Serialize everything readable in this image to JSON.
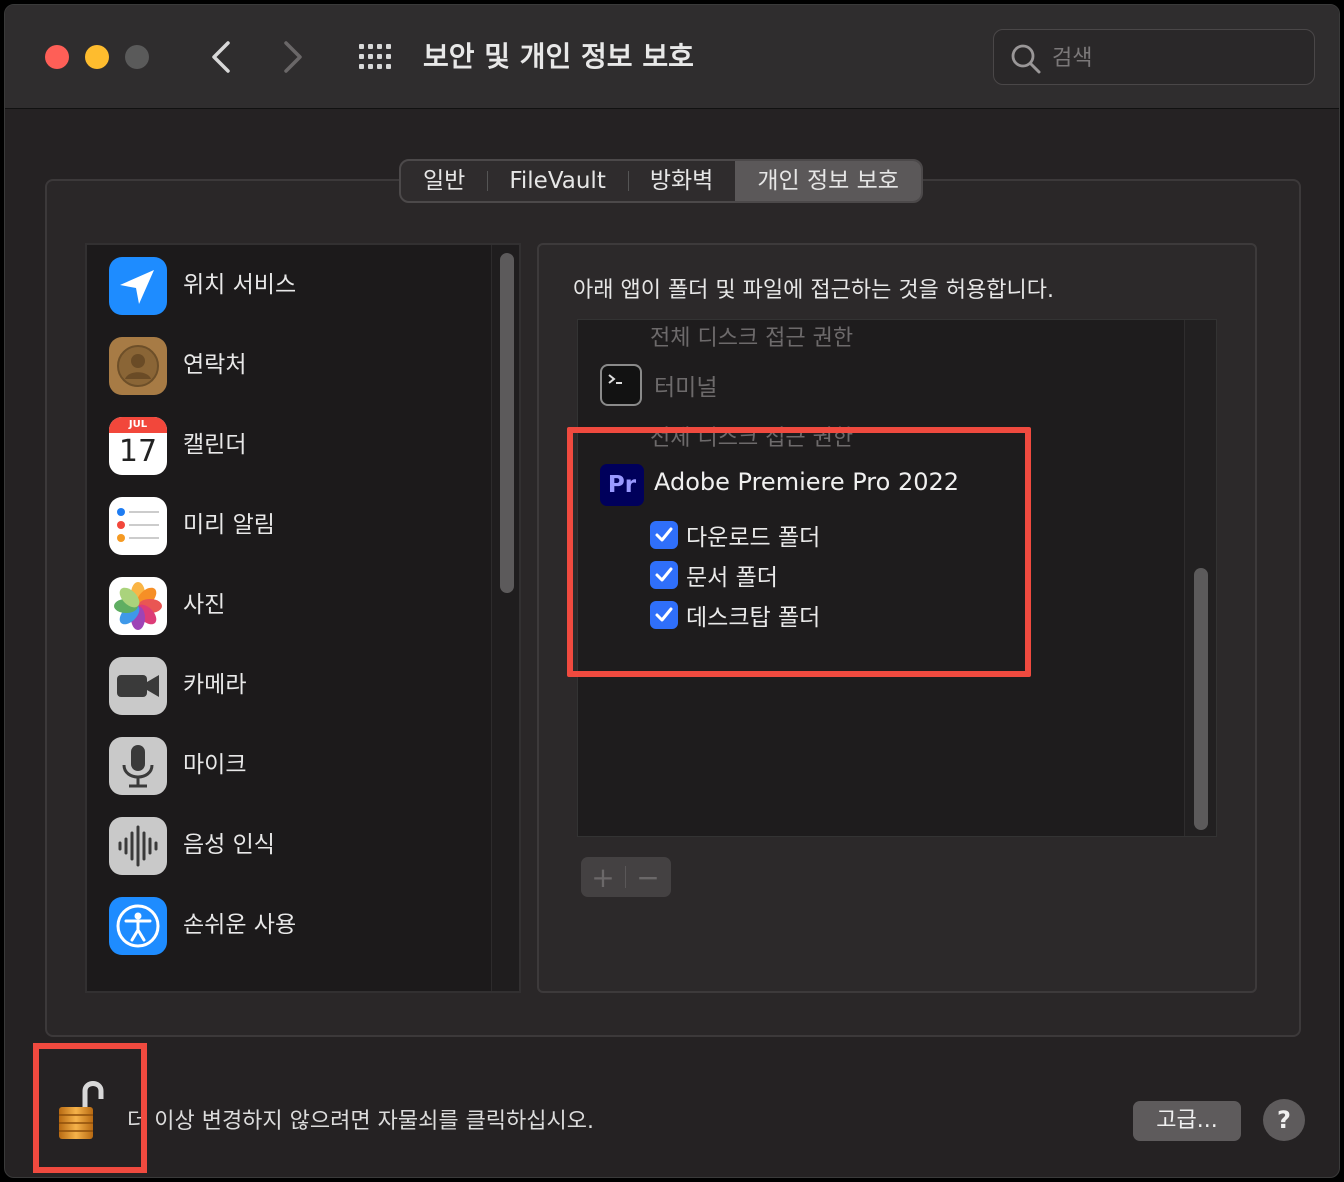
{
  "window": {
    "title": "보안 및 개인 정보 보호"
  },
  "search": {
    "placeholder": "검색"
  },
  "tabs": [
    {
      "label": "일반",
      "active": false
    },
    {
      "label": "FileVault",
      "active": false
    },
    {
      "label": "방화벽",
      "active": false
    },
    {
      "label": "개인 정보 보호",
      "active": true
    }
  ],
  "sidebar": {
    "items": [
      {
        "label": "위치 서비스",
        "icon": "location-arrow-icon"
      },
      {
        "label": "연락처",
        "icon": "contacts-icon"
      },
      {
        "label": "캘린더",
        "icon": "calendar-icon",
        "month": "JUL",
        "day": "17"
      },
      {
        "label": "미리 알림",
        "icon": "reminders-icon"
      },
      {
        "label": "사진",
        "icon": "photos-icon"
      },
      {
        "label": "카메라",
        "icon": "camera-icon"
      },
      {
        "label": "마이크",
        "icon": "microphone-icon"
      },
      {
        "label": "음성 인식",
        "icon": "speech-recognition-icon"
      },
      {
        "label": "손쉬운 사용",
        "icon": "accessibility-icon"
      }
    ]
  },
  "panel": {
    "heading": "아래 앱이 폴더 및 파일에 접근하는 것을 허용합니다.",
    "group_head_1": "전체 디스크 접근 권한",
    "terminal_label": "터미널",
    "group_head_2": "전체 디스크 접근 권한",
    "app_icon_text": "Pr",
    "app_name": "Adobe Premiere Pro 2022",
    "permissions": [
      {
        "label": "다운로드 폴더",
        "checked": true
      },
      {
        "label": "문서 폴더",
        "checked": true
      },
      {
        "label": "데스크탑 폴더",
        "checked": true
      }
    ],
    "add_symbol": "+",
    "remove_symbol": "−"
  },
  "footer": {
    "lock_text": "더 이상 변경하지 않으려면 자물쇠를 클릭하십시오.",
    "advanced_label": "고급...",
    "help_label": "?"
  },
  "colors": {
    "highlight": "#f04a3f",
    "checkbox": "#2f6ffa",
    "location_blue": "#1e8cff"
  }
}
